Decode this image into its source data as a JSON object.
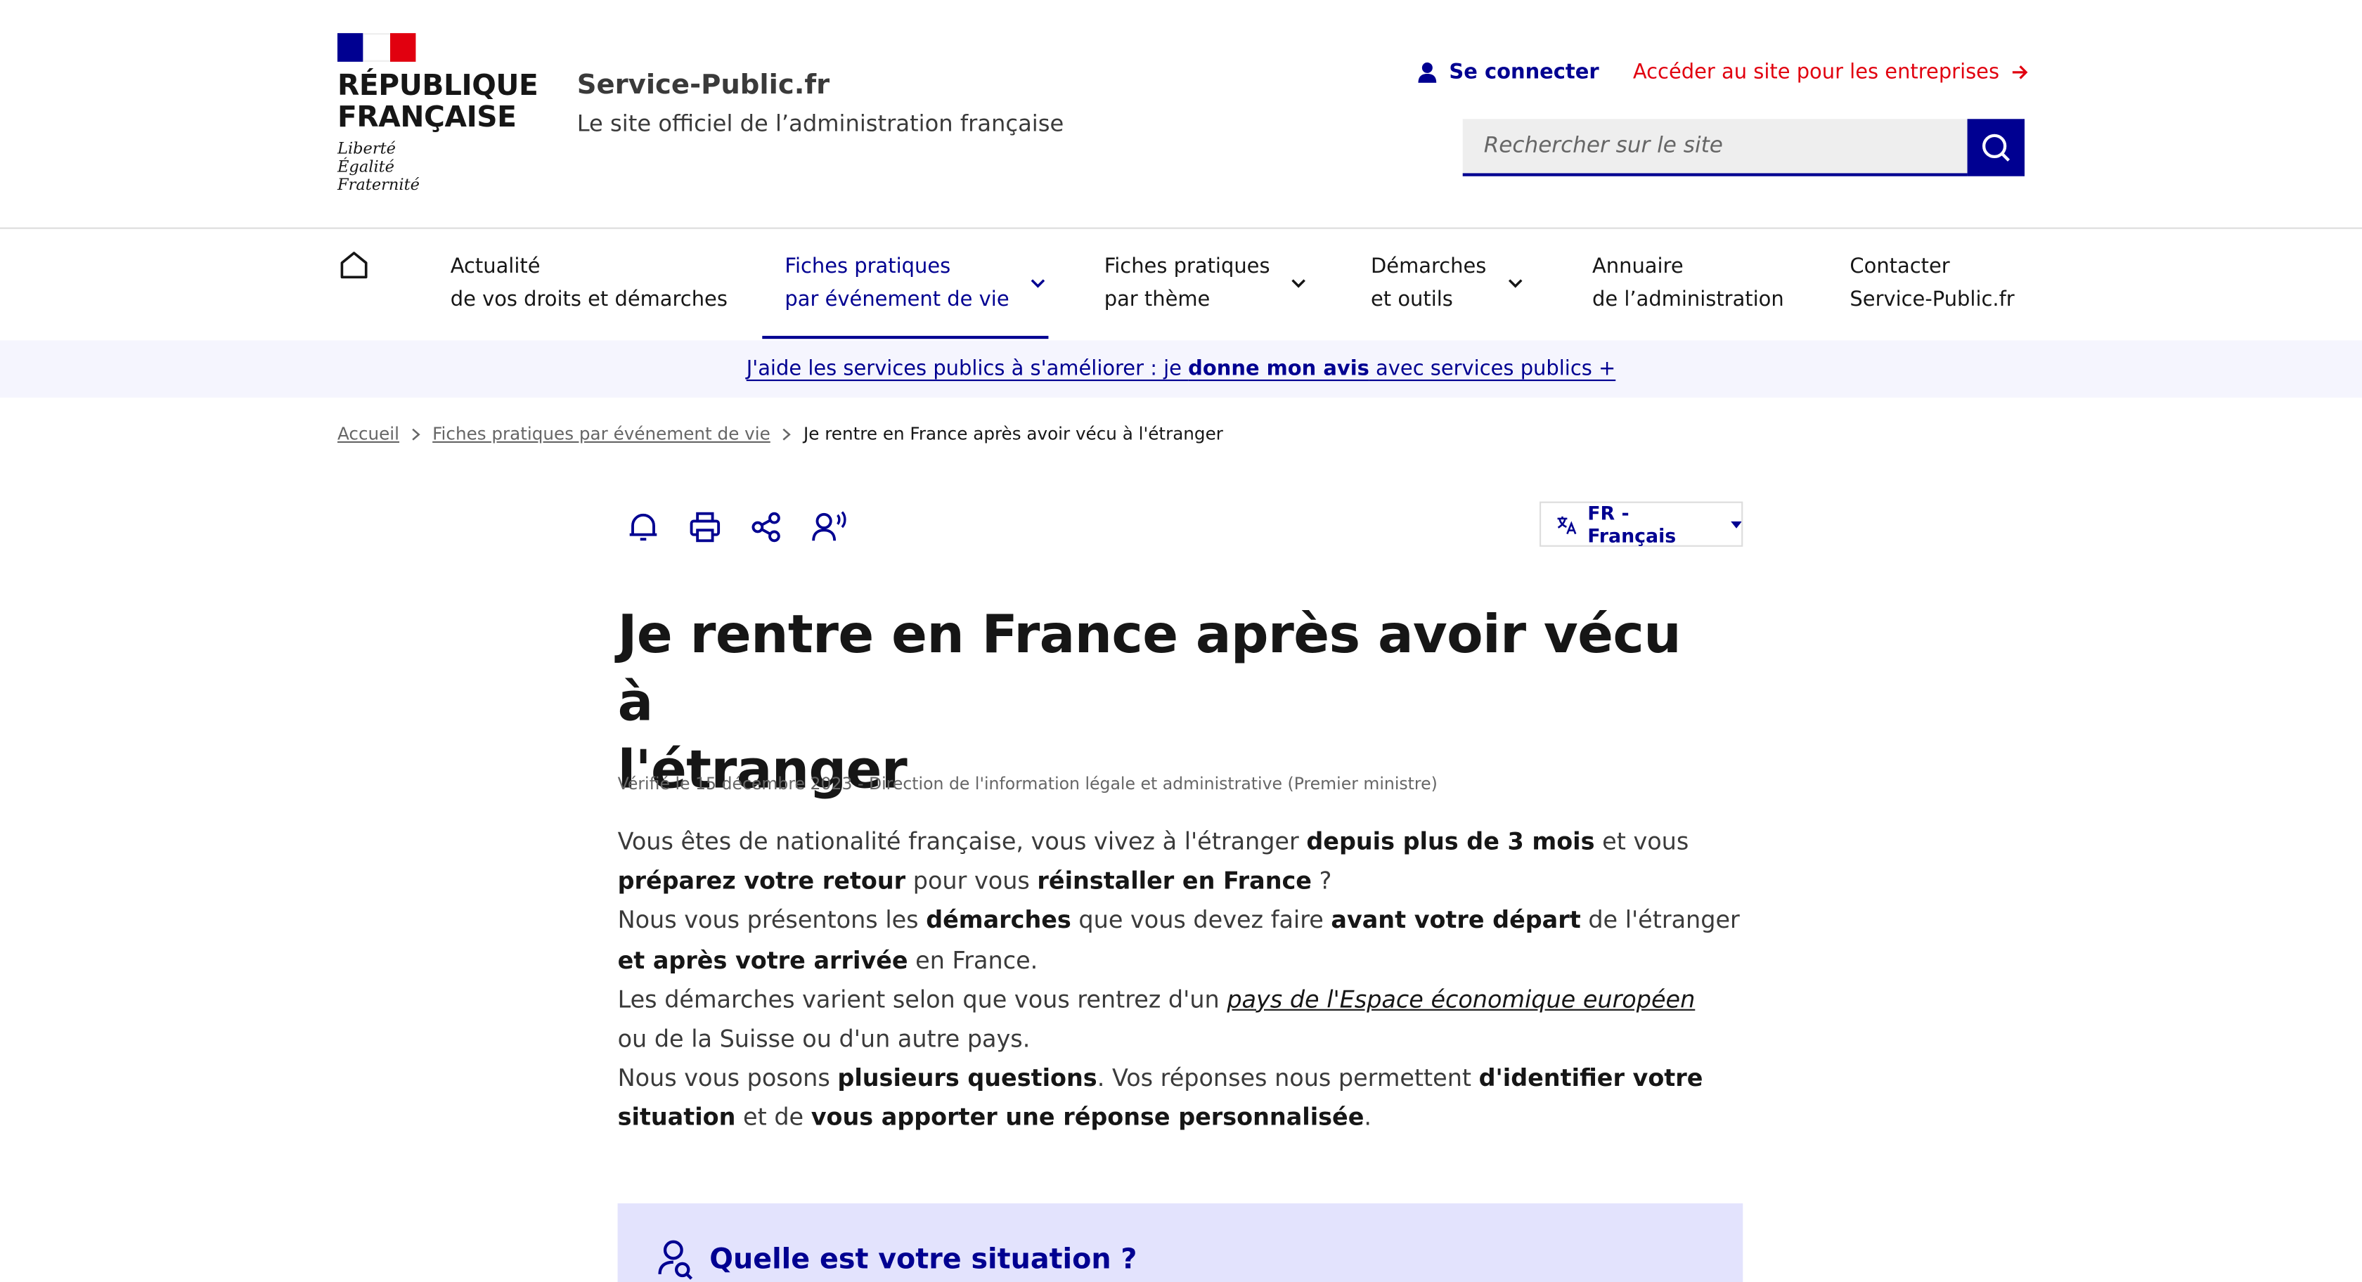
{
  "brand": {
    "rf_line1": "RÉPUBLIQUE",
    "rf_line2": "FRANÇAISE",
    "motto1": "Liberté",
    "motto2": "Égalité",
    "motto3": "Fraternité",
    "site_name": "Service-Public.fr",
    "site_tagline": "Le site officiel de l’administration française",
    "colors": {
      "blue": "#000091",
      "red": "#e1000f",
      "flag_blue": "#000091",
      "flag_white": "#ffffff",
      "flag_red": "#e1000f"
    }
  },
  "header": {
    "login_label": "Se connecter",
    "business_link": "Accéder au site pour les entreprises",
    "search_placeholder": "Rechercher sur le site"
  },
  "nav": {
    "home_icon": "home-icon",
    "items": [
      {
        "line1": "Actualité",
        "line2": "de vos droits et démarches",
        "has_menu": false
      },
      {
        "line1": "Fiches pratiques",
        "line2": "par événement de vie",
        "has_menu": true,
        "active": true
      },
      {
        "line1": "Fiches pratiques",
        "line2": "par thème",
        "has_menu": true
      },
      {
        "line1": "Démarches",
        "line2": "et outils",
        "has_menu": true
      },
      {
        "line1": "Annuaire",
        "line2": "de l’administration",
        "has_menu": false
      },
      {
        "line1": "Contacter",
        "line2": "Service-Public.fr",
        "has_menu": false
      }
    ]
  },
  "banner": {
    "text_before": "J'aide les services publics à s'améliorer : je ",
    "text_bold": "donne mon avis",
    "text_after": " avec services publics +"
  },
  "breadcrumb": {
    "home": "Accueil",
    "parent": "Fiches pratiques par événement de vie",
    "current": "Je rentre en France après avoir vécu à l'étranger"
  },
  "tools": {
    "icons": [
      "bell-icon",
      "print-icon",
      "share-icon",
      "listen-icon"
    ],
    "language": "FR - Français"
  },
  "article": {
    "title_line1": "Je rentre en France après avoir vécu à",
    "title_line2": "l'étranger",
    "meta": "Vérifié le 15 décembre 2023 - Direction de l'information légale et administrative (Premier ministre)",
    "p1": {
      "a": "Vous êtes de nationalité française, vous vivez à l'étranger ",
      "b": "depuis plus de 3 mois",
      "c": " et vous",
      "d": "préparez votre retour",
      "e": " pour vous ",
      "f": "réinstaller en France",
      "g": " ?"
    },
    "p2": {
      "a": "Nous vous présentons les ",
      "b": "démarches",
      "c": " que vous devez faire ",
      "d": "avant votre départ",
      "e": " de l'étranger",
      "f": "et après votre arrivée",
      "g": " en France."
    },
    "p3": {
      "a": "Les démarches varient selon que vous rentrez d'un ",
      "link": "pays de l'Espace économique européen",
      "b": "ou de la Suisse ou d'un autre pays."
    },
    "p4": {
      "a": "Nous vous posons ",
      "b": "plusieurs questions",
      "c": ". Vos réponses nous permettent ",
      "d": "d'identifier votre",
      "e": "situation",
      "f": " et de ",
      "g": "vous apporter une réponse personnalisée",
      "h": "."
    },
    "situation_title": "Quelle est votre situation ?"
  }
}
